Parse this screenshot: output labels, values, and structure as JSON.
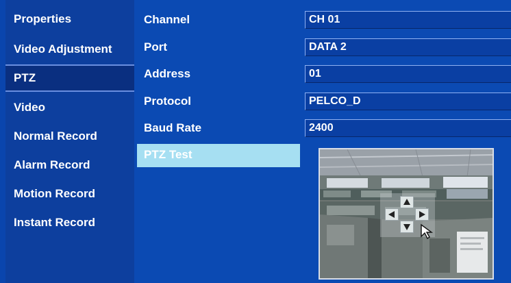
{
  "sidebar": {
    "items": [
      {
        "label": "Properties",
        "active": false
      },
      {
        "label": "Video Adjustment",
        "active": false
      },
      {
        "label": "PTZ",
        "active": true
      },
      {
        "label": "Video",
        "active": false
      },
      {
        "label": "Normal Record",
        "active": false
      },
      {
        "label": "Alarm Record",
        "active": false
      },
      {
        "label": "Motion Record",
        "active": false
      },
      {
        "label": "Instant Record",
        "active": false
      }
    ]
  },
  "settings": {
    "channel": {
      "label": "Channel",
      "value": "CH 01"
    },
    "port": {
      "label": "Port",
      "value": "DATA 2"
    },
    "address": {
      "label": "Address",
      "value": "01"
    },
    "protocol": {
      "label": "Protocol",
      "value": "PELCO_D"
    },
    "baud_rate": {
      "label": "Baud Rate",
      "value": "2400"
    }
  },
  "ptz_test": {
    "label": "PTZ Test"
  },
  "preview": {
    "icons": {
      "up": "arrow-up-icon",
      "down": "arrow-down-icon",
      "left": "arrow-left-icon",
      "right": "arrow-right-icon",
      "pointer": "mouse-pointer-icon"
    }
  },
  "colors": {
    "background": "#0a45ad",
    "sidebar": "#0d3f9e",
    "selected_highlight": "#a6dff2",
    "text": "#ffffff"
  }
}
